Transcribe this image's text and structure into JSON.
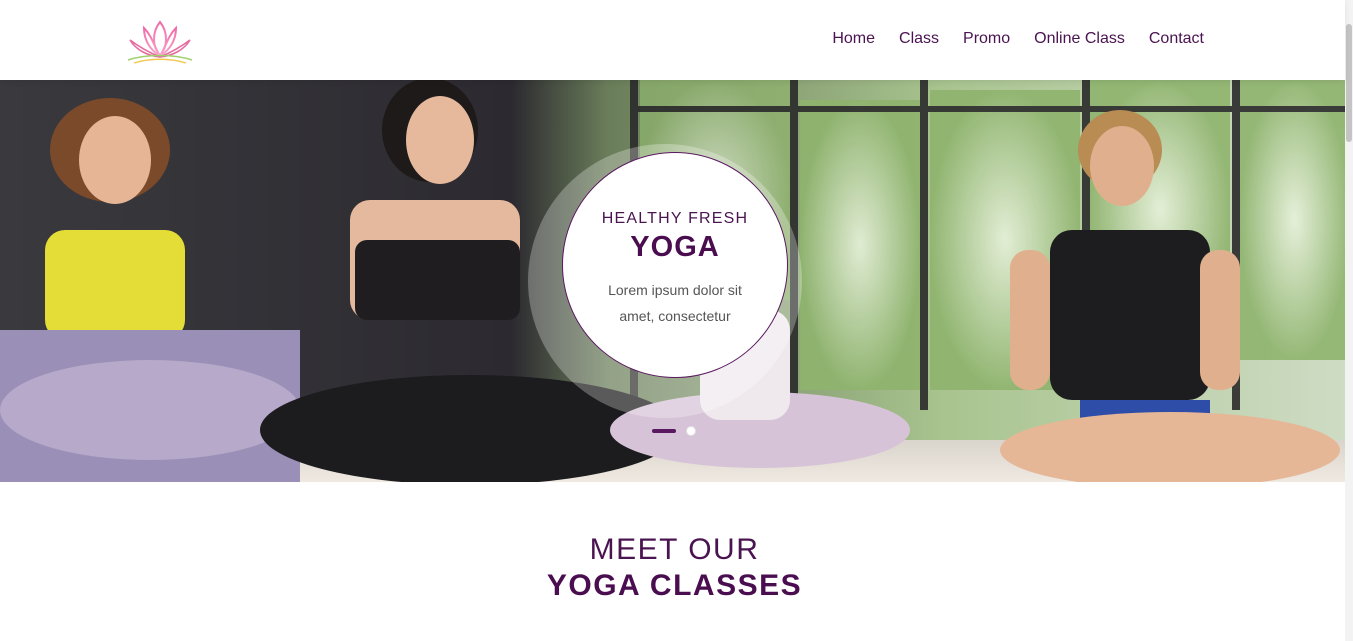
{
  "brand": {
    "logo_icon": "lotus-logo-icon"
  },
  "nav": {
    "items": [
      "Home",
      "Class",
      "Promo",
      "Online Class",
      "Contact"
    ]
  },
  "hero": {
    "image_icon": "yoga-class-photo",
    "badge": {
      "subtitle": "HEALTHY FRESH",
      "title": "YOGA",
      "text": "Lorem ipsum dolor sit amet, consectetur"
    },
    "carousel": {
      "slides": 2,
      "active_slide": 1
    }
  },
  "section": {
    "line1": "MEET OUR",
    "line2": "YOGA CLASSES"
  },
  "colors": {
    "primary": "#4a0d4f",
    "nav_text": "#4a1450",
    "body_text": "#555555"
  }
}
